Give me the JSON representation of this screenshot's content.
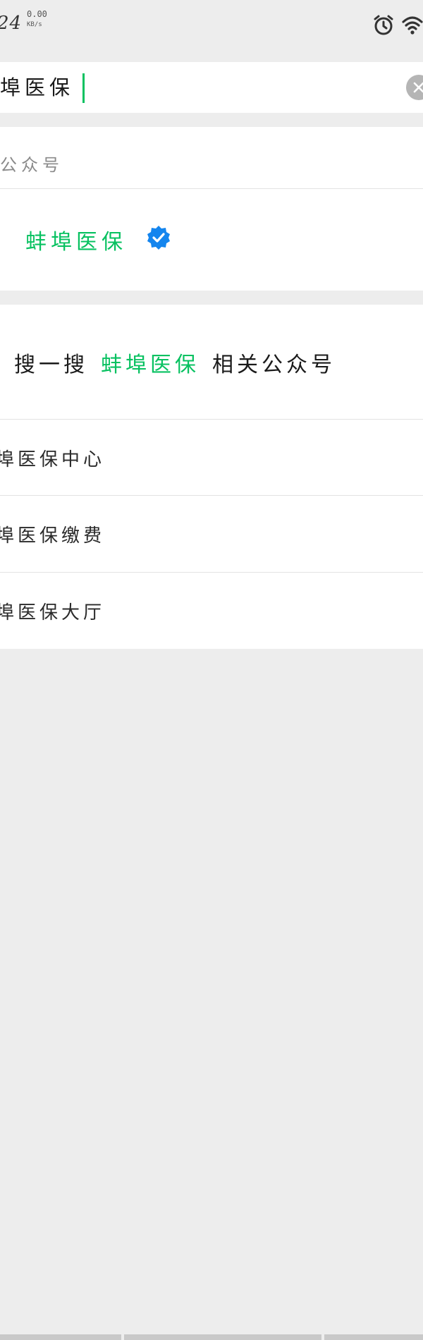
{
  "status_bar": {
    "time": "24",
    "speed_value": "0.00",
    "speed_unit": "KB/s",
    "icons": [
      "alarm-icon",
      "wifi-icon"
    ]
  },
  "search": {
    "query": "埠医保",
    "clear_icon": "close-circle-icon"
  },
  "official_accounts": {
    "section_title": "公众号",
    "result_name": "蚌埠医保",
    "verified_icon": "verified-badge-icon"
  },
  "search_more": {
    "prefix": "搜一搜",
    "keyword": "蚌埠医保",
    "suffix": "相关公众号"
  },
  "suggestions": [
    {
      "label": "埠医保中心"
    },
    {
      "label": "埠医保缴费"
    },
    {
      "label": "埠医保大厅"
    }
  ],
  "colors": {
    "accent": "#07c160",
    "verified": "#1485ee",
    "background": "#ededed"
  }
}
